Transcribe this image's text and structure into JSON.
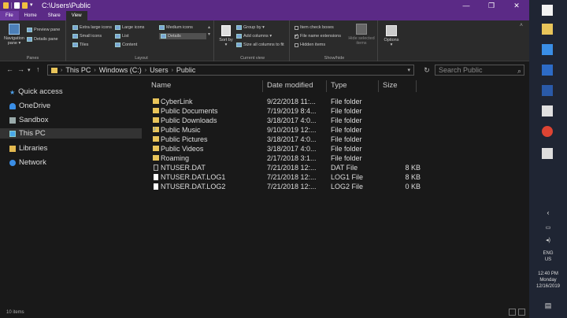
{
  "window": {
    "title": "C:\\Users\\Public",
    "controls": {
      "minimize": "—",
      "maximize": "❐",
      "close": "✕"
    }
  },
  "ribbon_tabs": [
    "File",
    "Home",
    "Share",
    "View"
  ],
  "ribbon": {
    "panes": {
      "navigation_pane": "Navigation pane ▾",
      "preview_pane": "Preview pane",
      "details_pane": "Details pane",
      "label": "Panes"
    },
    "layout": {
      "extra_large_icons": "Extra large icons",
      "large_icons": "Large icons",
      "medium_icons": "Medium icons",
      "small_icons": "Small icons",
      "list": "List",
      "details": "Details",
      "tiles": "Tiles",
      "content": "Content",
      "label": "Layout"
    },
    "current_view": {
      "sort_by": "Sort by ▾",
      "group_by": "Group by ▾",
      "add_columns": "Add columns ▾",
      "size_all_columns": "Size all columns to fit",
      "label": "Current view"
    },
    "show_hide": {
      "item_check_boxes": "Item check boxes",
      "file_name_extensions": "File name extensions",
      "hidden_items": "Hidden items",
      "hide_selected_items": "Hide selected items",
      "label": "Show/hide"
    },
    "options": "Options ▾"
  },
  "address": {
    "crumbs": [
      "This PC",
      "Windows (C:)",
      "Users",
      "Public"
    ],
    "search_placeholder": "Search Public"
  },
  "nav_pane": {
    "items": [
      {
        "label": "Quick access",
        "icon": "star-icon"
      },
      {
        "label": "OneDrive",
        "icon": "cloud-icon"
      },
      {
        "label": "Sandbox",
        "icon": "drive-icon"
      },
      {
        "label": "This PC",
        "icon": "computer-icon",
        "selected": true
      },
      {
        "label": "Libraries",
        "icon": "library-icon"
      },
      {
        "label": "Network",
        "icon": "network-icon"
      }
    ]
  },
  "file_list": {
    "columns": [
      "Name",
      "Date modified",
      "Type",
      "Size"
    ],
    "rows": [
      {
        "name": "CyberLink",
        "date": "9/22/2018 11:...",
        "type": "File folder",
        "size": "",
        "icon": "folder-icon"
      },
      {
        "name": "Public Documents",
        "date": "7/19/2019 8:4...",
        "type": "File folder",
        "size": "",
        "icon": "folder-icon"
      },
      {
        "name": "Public Downloads",
        "date": "3/18/2017 4:0...",
        "type": "File folder",
        "size": "",
        "icon": "folder-icon"
      },
      {
        "name": "Public Music",
        "date": "9/10/2019 12:...",
        "type": "File folder",
        "size": "",
        "icon": "music-folder-icon"
      },
      {
        "name": "Public Pictures",
        "date": "3/18/2017 4:0...",
        "type": "File folder",
        "size": "",
        "icon": "folder-icon"
      },
      {
        "name": "Public Videos",
        "date": "3/18/2017 4:0...",
        "type": "File folder",
        "size": "",
        "icon": "folder-icon"
      },
      {
        "name": "Roaming",
        "date": "2/17/2018 3:1...",
        "type": "File folder",
        "size": "",
        "icon": "folder-icon"
      },
      {
        "name": "NTUSER.DAT",
        "date": "7/21/2018 12:...",
        "type": "DAT File",
        "size": "8 KB",
        "icon": "dat-file-icon"
      },
      {
        "name": "NTUSER.DAT.LOG1",
        "date": "7/21/2018 12:...",
        "type": "LOG1 File",
        "size": "8 KB",
        "icon": "file-icon"
      },
      {
        "name": "NTUSER.DAT.LOG2",
        "date": "7/21/2018 12:...",
        "type": "LOG2 File",
        "size": "0 KB",
        "icon": "file-icon"
      }
    ]
  },
  "status": {
    "count": "10 items"
  },
  "tray": {
    "lang": "ENG",
    "region": "US",
    "time": "12:40 PM",
    "day": "Monday",
    "date": "12/16/2019"
  }
}
